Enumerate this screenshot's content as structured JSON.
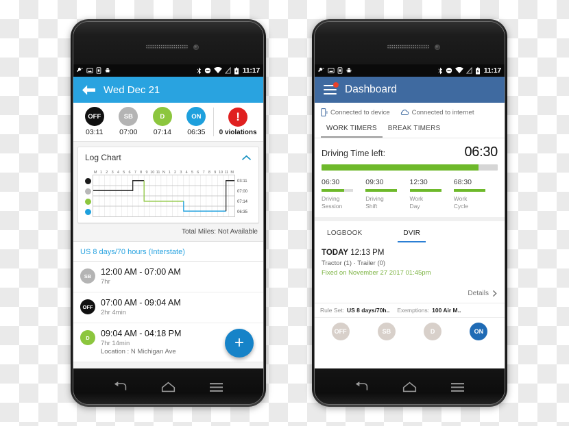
{
  "left_phone": {
    "statusbar": {
      "time": "11:17",
      "left_icons": [
        "wrench-icon",
        "image-icon",
        "sim-card-icon",
        "android-icon"
      ],
      "right_icons": [
        "bluetooth-icon",
        "do-not-disturb-icon",
        "wifi-icon",
        "signal-icon",
        "battery-icon"
      ]
    },
    "appbar": {
      "back_icon": "back-arrow-icon",
      "title": "Wed Dec 21"
    },
    "status_row": [
      {
        "code": "OFF",
        "time": "03:11",
        "cls": "c-off"
      },
      {
        "code": "SB",
        "time": "07:00",
        "cls": "c-sb"
      },
      {
        "code": "D",
        "time": "07:14",
        "cls": "c-d"
      },
      {
        "code": "ON",
        "time": "06:35",
        "cls": "c-on"
      }
    ],
    "violations": {
      "icon": "!",
      "label": "0 violations"
    },
    "log_chart": {
      "title": "Log Chart",
      "collapse_icon": "chevron-up-icon",
      "tick_labels": [
        "M",
        "1",
        "2",
        "3",
        "4",
        "5",
        "6",
        "7",
        "8",
        "9",
        "10",
        "11",
        "N",
        "1",
        "2",
        "3",
        "4",
        "5",
        "6",
        "7",
        "8",
        "9",
        "10",
        "11",
        "M"
      ],
      "row_totals": [
        "03:11",
        "07:00",
        "07:14",
        "06:35"
      ],
      "rows": [
        "OFF",
        "SB",
        "D",
        "ON"
      ]
    },
    "total_miles": "Total Miles: Not Available",
    "rule_link": "US 8 days/70 hours (Interstate)",
    "entries": [
      {
        "code": "SB",
        "cls": "c-sb",
        "range": "12:00 AM - 07:00 AM",
        "duration": "7hr",
        "location": ""
      },
      {
        "code": "OFF",
        "cls": "c-off",
        "range": "07:00 AM - 09:04 AM",
        "duration": "2hr 4min",
        "location": ""
      },
      {
        "code": "D",
        "cls": "c-d",
        "range": "09:04 AM - 04:18 PM",
        "duration": "7hr 14min",
        "location": "Location : N Michigan Ave"
      }
    ],
    "fab": {
      "icon": "plus-icon",
      "label": "+"
    },
    "navbar": [
      "back-icon",
      "home-icon",
      "recents-icon"
    ]
  },
  "right_phone": {
    "statusbar": {
      "time": "11:17",
      "left_icons": [
        "wrench-icon",
        "image-icon",
        "sim-card-icon",
        "android-icon"
      ],
      "right_icons": [
        "bluetooth-icon",
        "do-not-disturb-icon",
        "wifi-icon",
        "signal-icon",
        "battery-icon"
      ]
    },
    "appbar": {
      "menu_icon": "hamburger-icon",
      "title": "Dashboard",
      "badge": true
    },
    "connection": [
      {
        "icon": "device-icon",
        "label": "Connected to device"
      },
      {
        "icon": "cloud-icon",
        "label": "Connected to internet"
      }
    ],
    "timer_tabs": [
      {
        "label": "WORK TIMERS",
        "active": true
      },
      {
        "label": "BREAK TIMERS",
        "active": false
      }
    ],
    "driving": {
      "label": "Driving Time left:",
      "value": "06:30",
      "progress_pct": 89
    },
    "mini_timers": [
      {
        "value": "06:30",
        "caption_1": "Driving",
        "caption_2": "Session",
        "pct": 72
      },
      {
        "value": "09:30",
        "caption_1": "Driving",
        "caption_2": "Shift",
        "pct": 100
      },
      {
        "value": "12:30",
        "caption_1": "Work",
        "caption_2": "Day",
        "pct": 100
      },
      {
        "value": "68:30",
        "caption_1": "Work",
        "caption_2": "Cycle",
        "pct": 100
      }
    ],
    "dvir_tabs": [
      {
        "label": "LOGBOOK",
        "active": false
      },
      {
        "label": "DVIR",
        "active": true
      }
    ],
    "dvir": {
      "today_label": "TODAY",
      "today_time": "12:13 PM",
      "sub": "Tractor (1) · Trailer (0)",
      "fixed": "Fixed on November 27 2017 01:45pm",
      "details_label": "Details",
      "details_icon": "chevron-right-icon"
    },
    "ruleset": {
      "rule_key": "Rule Set:",
      "rule_value": "US 8 days/70h..",
      "exempt_key": "Exemptions:",
      "exempt_value": "100 Air M.."
    },
    "status_buttons": [
      {
        "code": "OFF",
        "active": false
      },
      {
        "code": "SB",
        "active": false
      },
      {
        "code": "D",
        "active": false
      },
      {
        "code": "ON",
        "active": true
      }
    ],
    "navbar": [
      "back-icon",
      "home-icon",
      "recents-icon"
    ]
  },
  "colors": {
    "blue_appbar": "#29a3e0",
    "steel_appbar": "#3f6aa0",
    "green": "#8cc63e",
    "progress_green": "#6eb92b",
    "on_blue": "#1ea0dd",
    "red": "#e02020",
    "fab_blue": "#1683c8"
  }
}
